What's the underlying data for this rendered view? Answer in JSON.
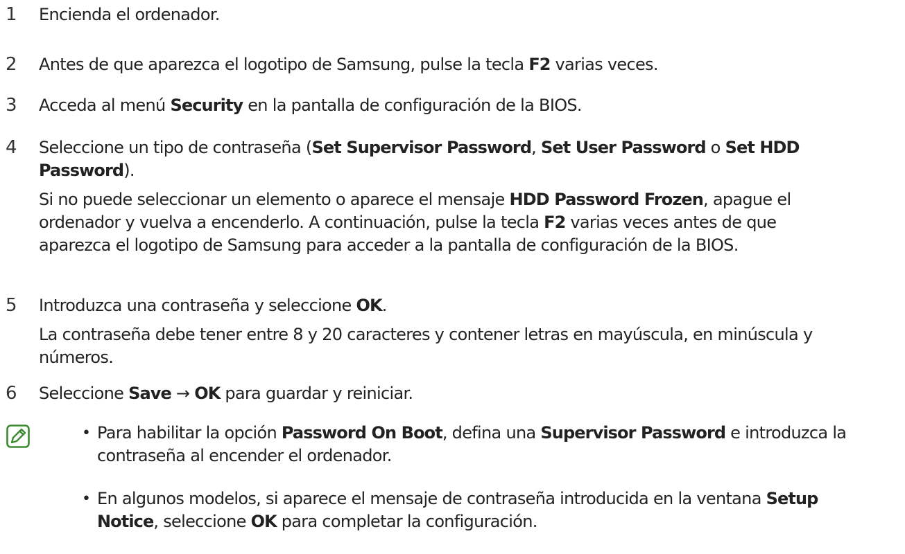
{
  "steps": [
    {
      "number": "1",
      "lines": [
        [
          {
            "t": "Encienda el ordenador.",
            "b": false
          }
        ]
      ]
    },
    {
      "number": "2",
      "lines": [
        [
          {
            "t": "Antes de que aparezca el logotipo de Samsung, pulse la tecla ",
            "b": false
          },
          {
            "t": "F2",
            "b": true
          },
          {
            "t": " varias veces.",
            "b": false
          }
        ]
      ]
    },
    {
      "number": "3",
      "lines": [
        [
          {
            "t": "Acceda al menú ",
            "b": false
          },
          {
            "t": "Security",
            "b": true
          },
          {
            "t": " en la pantalla de configuración de la BIOS.",
            "b": false
          }
        ]
      ]
    },
    {
      "number": "4",
      "lines": [
        [
          {
            "t": "Seleccione un tipo de contraseña (",
            "b": false
          },
          {
            "t": "Set Supervisor Password",
            "b": true
          },
          {
            "t": ", ",
            "b": false
          },
          {
            "t": "Set User Password",
            "b": true
          },
          {
            "t": " o ",
            "b": false
          },
          {
            "t": "Set HDD",
            "b": true
          }
        ],
        [
          {
            "t": "Password",
            "b": true
          },
          {
            "t": ").",
            "b": false
          }
        ],
        [
          {
            "t": "Si no puede seleccionar un elemento o aparece el mensaje ",
            "b": false
          },
          {
            "t": "HDD Password Frozen",
            "b": true
          },
          {
            "t": ", apague el",
            "b": false
          }
        ],
        [
          {
            "t": "ordenador y vuelva a encenderlo. A continuación, pulse la tecla ",
            "b": false
          },
          {
            "t": "F2",
            "b": true
          },
          {
            "t": " varias veces antes de que",
            "b": false
          }
        ],
        [
          {
            "t": "aparezca el logotipo de Samsung para acceder a la pantalla de configuración de la BIOS.",
            "b": false
          }
        ]
      ]
    },
    {
      "number": "5",
      "lines": [
        [
          {
            "t": "Introduzca una contraseña y seleccione ",
            "b": false
          },
          {
            "t": "OK",
            "b": true
          },
          {
            "t": ".",
            "b": false
          }
        ],
        [
          {
            "t": "La contraseña debe tener entre 8 y 20 caracteres y contener letras en mayúscula, en minúscula y",
            "b": false
          }
        ],
        [
          {
            "t": "números.",
            "b": false
          }
        ]
      ]
    },
    {
      "number": "6",
      "lines": [
        [
          {
            "t": "Seleccione ",
            "b": false
          },
          {
            "t": "Save",
            "b": true
          },
          {
            "t": " → ",
            "b": false
          },
          {
            "t": "OK",
            "b": true
          },
          {
            "t": " para guardar y reiniciar.",
            "b": false
          }
        ]
      ]
    }
  ],
  "note": {
    "icon": "note-pencil-icon",
    "bullet_symbol": "•",
    "bullets": [
      {
        "lines": [
          [
            {
              "t": "Para habilitar la opción ",
              "b": false
            },
            {
              "t": "Password On Boot",
              "b": true
            },
            {
              "t": ", defina una ",
              "b": false
            },
            {
              "t": "Supervisor Password",
              "b": true
            },
            {
              "t": " e introduzca la",
              "b": false
            }
          ],
          [
            {
              "t": "contraseña al encender el ordenador.",
              "b": false
            }
          ]
        ]
      },
      {
        "lines": [
          [
            {
              "t": "En algunos modelos, si aparece el mensaje de contraseña introducida en la ventana ",
              "b": false
            },
            {
              "t": "Setup",
              "b": true
            }
          ],
          [
            {
              "t": "Notice",
              "b": true
            },
            {
              "t": ", seleccione ",
              "b": false
            },
            {
              "t": "OK",
              "b": true
            },
            {
              "t": " para completar la configuración.",
              "b": false
            }
          ]
        ]
      }
    ],
    "icon_color": "#3a8a2e"
  }
}
